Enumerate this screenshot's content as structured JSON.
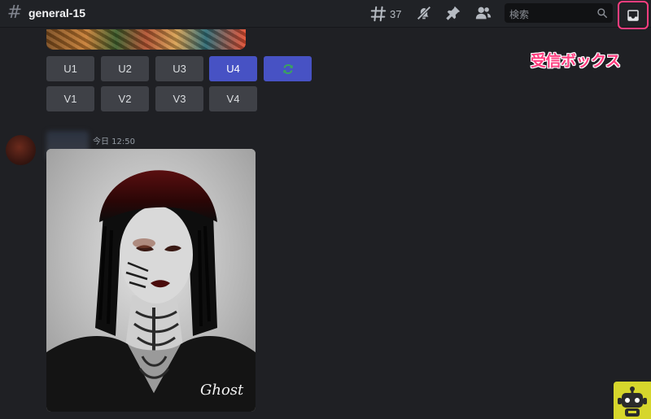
{
  "header": {
    "channel_name": "general-15",
    "threads_count": "37",
    "search_placeholder": "検索"
  },
  "annotation": {
    "label": "受信ボックス"
  },
  "buttons": {
    "upscale": [
      "U1",
      "U2",
      "U3",
      "U4"
    ],
    "variation": [
      "V1",
      "V2",
      "V3",
      "V4"
    ],
    "active": "U4"
  },
  "message": {
    "timestamp": "今日 12:50",
    "signature": "Ghost"
  },
  "colors": {
    "background": "#1f2024",
    "accent": "#4752c4",
    "highlight": "#ff3d7f",
    "badge": "#d6d62c"
  },
  "icons": {
    "channel": "hash-icon",
    "threads": "threads-icon",
    "notifications": "bell-muted-icon",
    "pin": "pin-icon",
    "members": "members-icon",
    "search": "search-icon",
    "inbox": "inbox-icon",
    "refresh": "refresh-icon",
    "robot": "robot-icon"
  }
}
